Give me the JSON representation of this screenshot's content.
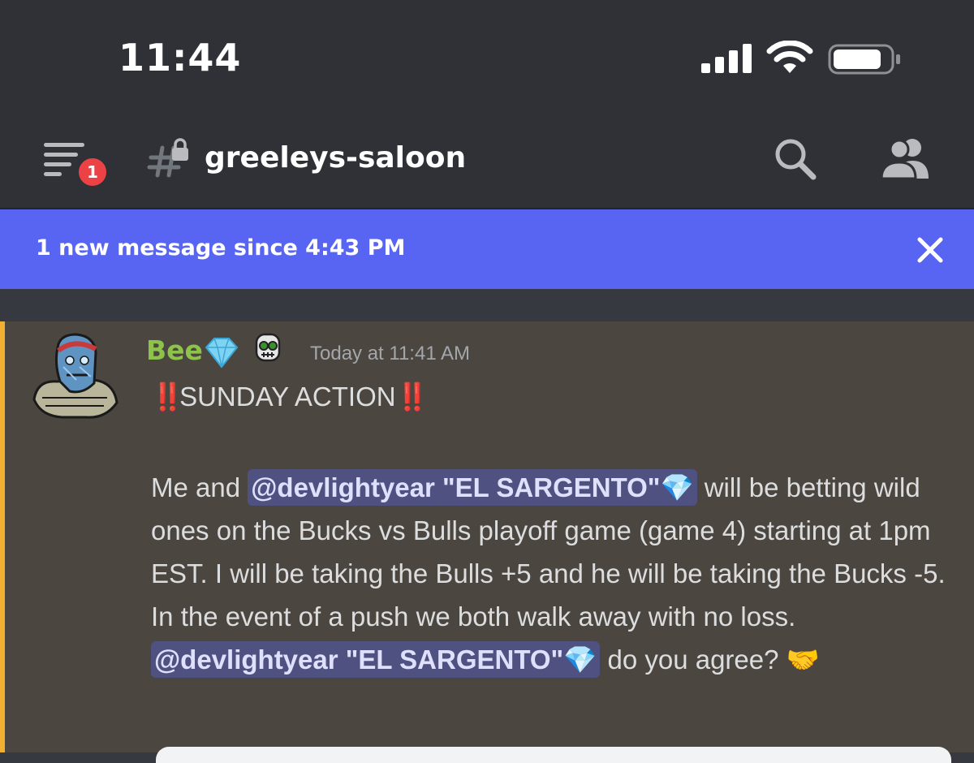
{
  "status_bar": {
    "time": "11:44",
    "signal_bars": 4,
    "battery_level": 0.85
  },
  "header": {
    "unread_badge": "1",
    "channel_name": "greeleys-saloon",
    "channel_locked": true
  },
  "new_messages_bar": {
    "text": "1 new message since 4:43 PM"
  },
  "message": {
    "author": "Bee",
    "author_color": "#8dc34a",
    "timestamp": "Today at 11:41 AM",
    "title_prefix": "‼️",
    "title": "SUNDAY ACTION",
    "title_suffix": "‼️",
    "body_part1": "Me and ",
    "mention1": "@devlightyear \"EL SARGENTO\"💎",
    "body_part2": " will be betting wild ones on the Bucks vs Bulls playoff game (game 4) starting at 1pm EST. I will be taking the Bulls +5 and he will be taking the Bucks -5. In the event of a push we both walk away with no loss. ",
    "mention2": "@devlightyear \"EL SARGENTO\"💎",
    "body_part3": " do you agree? 🤝"
  },
  "colors": {
    "background": "#36393f",
    "header": "#2f3136",
    "accent_blurple": "#5865f2",
    "highlight_bar": "#f0b132",
    "badge": "#ed4245"
  }
}
